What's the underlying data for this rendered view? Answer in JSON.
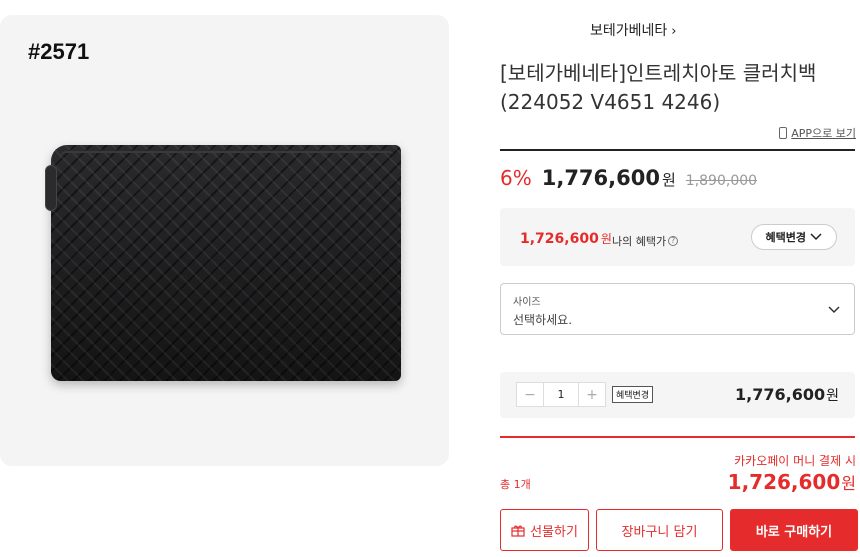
{
  "image_panel": {
    "product_code": "#2571",
    "product_image_alt": "woven leather clutch"
  },
  "brand": {
    "name": "보테가베네타",
    "chevron": "›"
  },
  "product": {
    "title": "[보테가베네타]인트레치아토 클러치백 (224052 V4651 4246)"
  },
  "app_link": {
    "label": "APP으로 보기",
    "icon": "phone-icon"
  },
  "pricing": {
    "discount": "6%",
    "price": "1,776,600",
    "currency": "원",
    "original_price": "1,890,000"
  },
  "benefit": {
    "price": "1,726,600",
    "currency": "원",
    "label": "나의 혜택가",
    "info_icon": "?",
    "change_button": "혜택변경"
  },
  "size_select": {
    "label": "사이즈",
    "placeholder": "선택하세요."
  },
  "quantity": {
    "minus": "−",
    "value": "1",
    "plus": "+",
    "benefit_button": "혜택변경",
    "price": "1,776,600",
    "currency": "원"
  },
  "total": {
    "kakao_text": "카카오페이 머니 결제 시",
    "count_label": "총 1개",
    "price": "1,726,600",
    "currency": "원"
  },
  "buttons": {
    "gift": "선물하기",
    "cart": "장바구니 담기",
    "buy": "바로 구매하기"
  },
  "colors": {
    "accent": "#e52b2b",
    "text": "#222222",
    "panel_bg": "#f5f5f5"
  }
}
